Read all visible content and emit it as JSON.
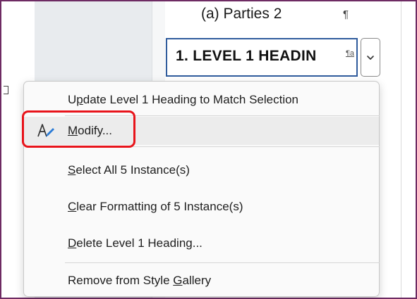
{
  "document": {
    "style_preview": "(a)  Parties 2",
    "pilcrow": "¶"
  },
  "style_box": {
    "label": "1.  LEVEL 1 HEADIN",
    "type_glyph": "¶a"
  },
  "menu": {
    "items": [
      {
        "pre": "U",
        "acc": "p",
        "post": "date Level 1 Heading to Match Selection"
      },
      {
        "pre": "",
        "acc": "M",
        "post": "odify..."
      },
      {
        "pre": "",
        "acc": "S",
        "post": "elect All 5 Instance(s)"
      },
      {
        "pre": "",
        "acc": "C",
        "post": "lear Formatting of 5 Instance(s)"
      },
      {
        "pre": "",
        "acc": "D",
        "post": "elete Level 1 Heading..."
      },
      {
        "pre": "Remove from Style ",
        "acc": "G",
        "post": "allery"
      }
    ]
  },
  "colors": {
    "highlight_ring": "#e8141b",
    "style_box_border": "#2f5b9c",
    "window_border": "#6e2b63",
    "icon_accent": "#2b7bd6"
  }
}
